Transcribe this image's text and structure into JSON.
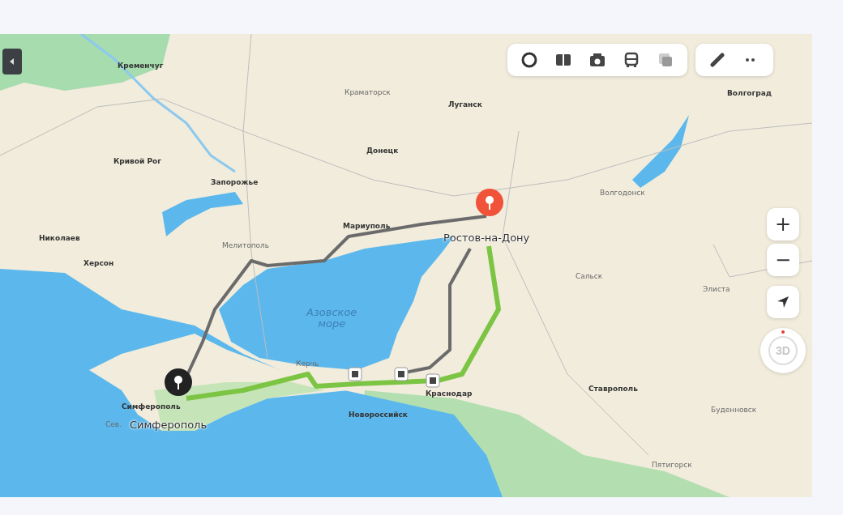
{
  "map": {
    "labels": [
      {
        "text": "Кременчуг",
        "kind": "city"
      },
      {
        "text": "Краматорск",
        "kind": "town"
      },
      {
        "text": "Луганск",
        "kind": "city"
      },
      {
        "text": "Кривой Рог",
        "kind": "city"
      },
      {
        "text": "Донецк",
        "kind": "city"
      },
      {
        "text": "Запорожье",
        "kind": "city"
      },
      {
        "text": "Мариуполь",
        "kind": "city"
      },
      {
        "text": "Николаев",
        "kind": "city"
      },
      {
        "text": "Мелитополь",
        "kind": "town"
      },
      {
        "text": "Херсон",
        "kind": "city"
      },
      {
        "text": "Волгоград",
        "kind": "city"
      },
      {
        "text": "Волгодонск",
        "kind": "town"
      },
      {
        "text": "Ростов-на-Дону",
        "kind": "endpoint"
      },
      {
        "text": "Сальск",
        "kind": "town"
      },
      {
        "text": "Элиста",
        "kind": "town"
      },
      {
        "text": "Азовское\nморе",
        "kind": "sea"
      },
      {
        "text": "Керчь",
        "kind": "town"
      },
      {
        "text": "Симферополь",
        "kind": "city"
      },
      {
        "text": "Сев.",
        "kind": "town"
      },
      {
        "text": "Симферополь",
        "kind": "endpoint"
      },
      {
        "text": "Новороссийск",
        "kind": "city"
      },
      {
        "text": "Краснодар",
        "kind": "city"
      },
      {
        "text": "Ставрополь",
        "kind": "city"
      },
      {
        "text": "Буденновск",
        "kind": "town"
      },
      {
        "text": "Пятигорск",
        "kind": "town"
      }
    ]
  },
  "controls": {
    "zoom_in": "+",
    "zoom_out": "−",
    "compass": "3D"
  }
}
